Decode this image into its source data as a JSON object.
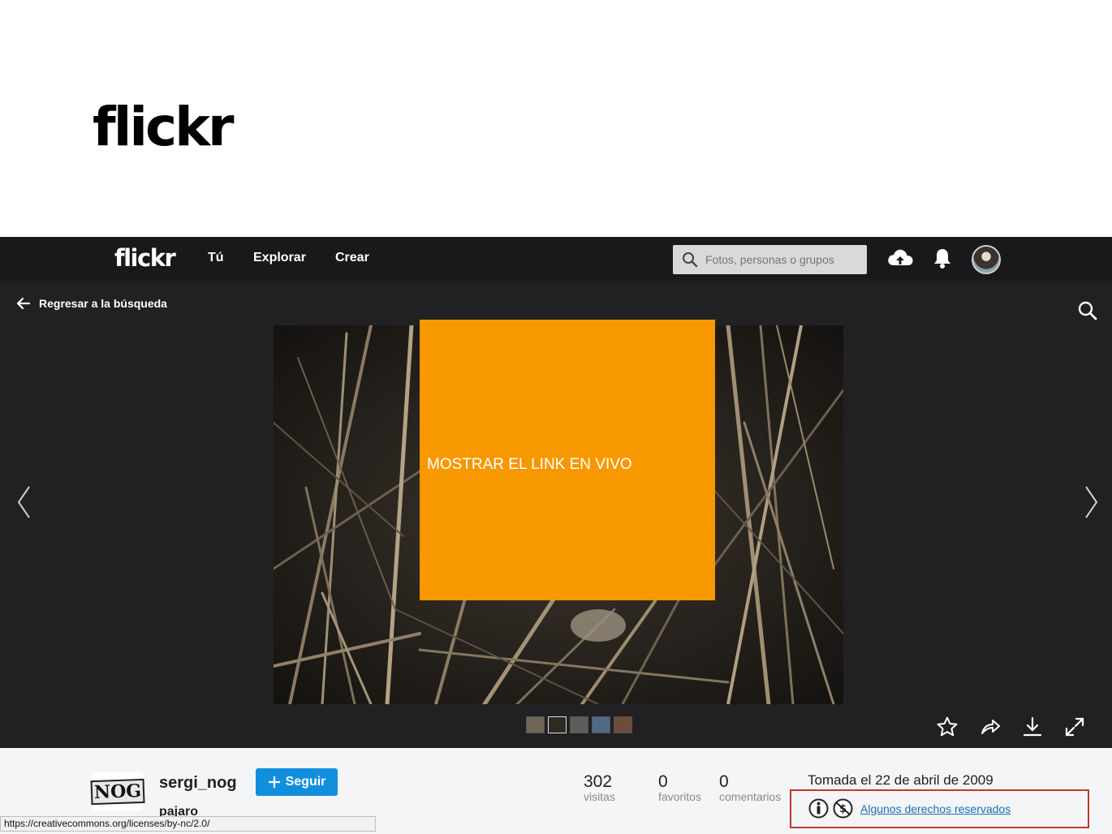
{
  "slide": {
    "title": "flickr"
  },
  "nav": {
    "logo": "flickr",
    "links": [
      "Tú",
      "Explorar",
      "Crear"
    ],
    "search_placeholder": "Fotos, personas o grupos"
  },
  "page": {
    "back_label": "Regresar a la búsqueda",
    "overlay_text": "MOSTRAR EL LINK EN VIVO"
  },
  "owner": {
    "avatar_text": "NOG",
    "name": "sergi_nog",
    "follow_label": "Seguir",
    "photo_title": "pajaro"
  },
  "stats": [
    {
      "num": "302",
      "label": "visitas"
    },
    {
      "num": "0",
      "label": "favoritos"
    },
    {
      "num": "0",
      "label": "comentarios"
    }
  ],
  "taken": "Tomada el 22 de abril de 2009",
  "license_text": "Algunos derechos reservados",
  "status_url": "https://creativecommons.org/licenses/by-nc/2.0/",
  "colors": {
    "follow": "#128fdc",
    "overlay": "#f79800",
    "highlight": "#c0392b",
    "link": "#1a6fb7"
  },
  "icons": [
    "search-icon",
    "upload-cloud-icon",
    "bell-icon",
    "back-arrow-icon",
    "chevron-left-icon",
    "chevron-right-icon",
    "star-icon",
    "share-icon",
    "download-icon",
    "expand-icon",
    "cc-by-icon",
    "cc-nc-icon"
  ]
}
